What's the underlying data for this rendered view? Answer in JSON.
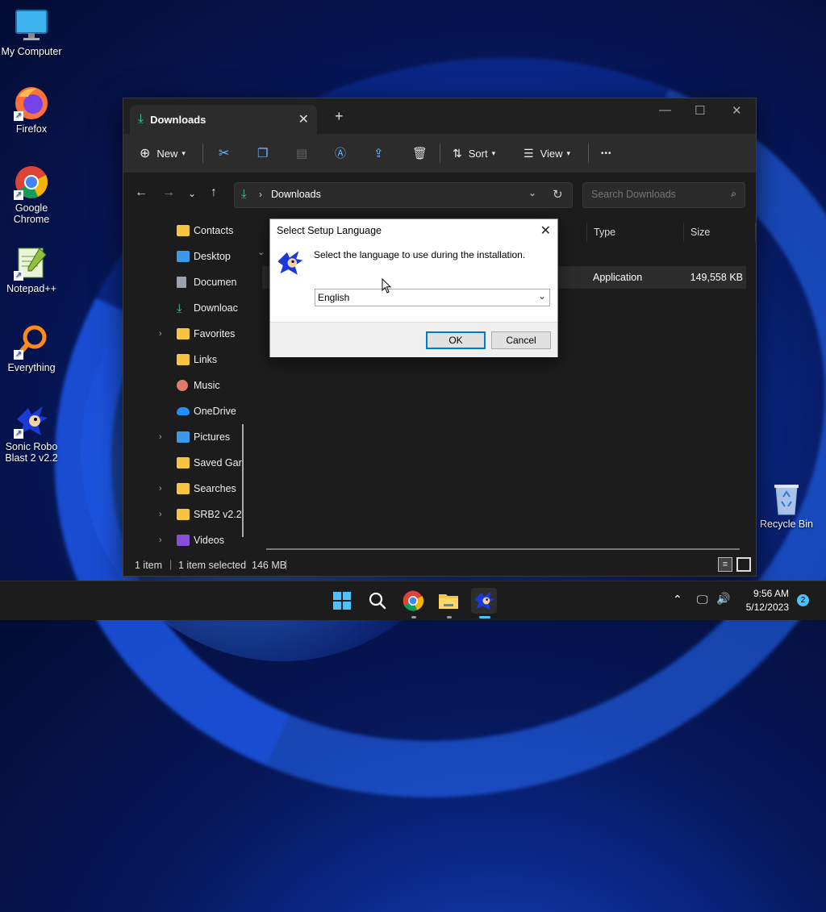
{
  "desktop": {
    "icons": [
      {
        "label": "My Computer"
      },
      {
        "label": "Firefox"
      },
      {
        "label": "Google Chrome"
      },
      {
        "label": "Notepad++"
      },
      {
        "label": "Everything"
      },
      {
        "label": "Sonic Robo Blast 2 v2.2"
      },
      {
        "label": "Recycle Bin"
      }
    ]
  },
  "explorer": {
    "tab_title": "Downloads",
    "toolbar": {
      "new_label": "New",
      "sort_label": "Sort",
      "view_label": "View",
      "more_label": "•••"
    },
    "address": {
      "path": "Downloads"
    },
    "search": {
      "placeholder": "Search Downloads"
    },
    "sidebar": [
      {
        "label": "Contacts",
        "expandable": false
      },
      {
        "label": "Desktop",
        "expandable": false
      },
      {
        "label": "Documen",
        "expandable": false
      },
      {
        "label": "Downloac",
        "expandable": false
      },
      {
        "label": "Favorites",
        "expandable": true
      },
      {
        "label": "Links",
        "expandable": false
      },
      {
        "label": "Music",
        "expandable": false
      },
      {
        "label": "OneDrive",
        "expandable": false
      },
      {
        "label": "Pictures",
        "expandable": true
      },
      {
        "label": "Saved Gar",
        "expandable": false
      },
      {
        "label": "Searches",
        "expandable": true
      },
      {
        "label": "SRB2 v2.2",
        "expandable": true
      },
      {
        "label": "Videos",
        "expandable": true
      }
    ],
    "columns": {
      "type": "Type",
      "size": "Size"
    },
    "file_row": {
      "type": "Application",
      "size": "149,558 KB"
    },
    "status": {
      "items": "1 item",
      "selected": "1 item selected  146 MB"
    }
  },
  "dialog": {
    "title": "Select Setup Language",
    "message": "Select the language to use during the installation.",
    "language": "English",
    "ok_label": "OK",
    "cancel_label": "Cancel"
  },
  "taskbar": {
    "time": "9:56 AM",
    "date": "5/12/2023",
    "notification_count": "2"
  }
}
